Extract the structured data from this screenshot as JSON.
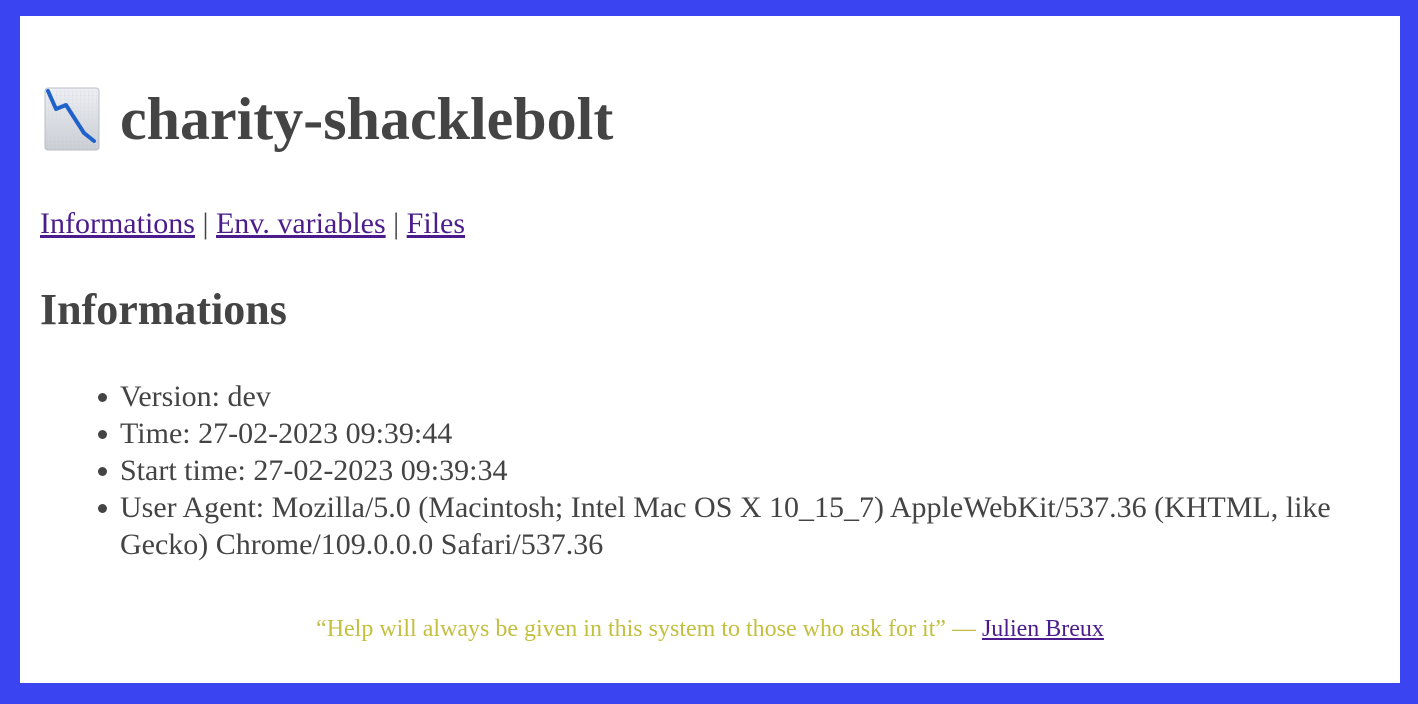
{
  "header": {
    "icon": "chart-decreasing-icon",
    "title": "charity-shacklebolt"
  },
  "nav": {
    "links": [
      "Informations",
      "Env. variables",
      "Files"
    ],
    "separator": "|"
  },
  "section": {
    "title": "Informations"
  },
  "info": [
    {
      "label": "Version:",
      "value": "dev"
    },
    {
      "label": "Time:",
      "value": "27-02-2023 09:39:44"
    },
    {
      "label": "Start time:",
      "value": "27-02-2023 09:39:34"
    },
    {
      "label": "User Agent:",
      "value": "Mozilla/5.0 (Macintosh; Intel Mac OS X 10_15_7) AppleWebKit/537.36 (KHTML, like Gecko) Chrome/109.0.0.0 Safari/537.36"
    }
  ],
  "footer": {
    "quote": "“Help will always be given in this system to those who ask for it” —",
    "author": "Julien Breux"
  },
  "colors": {
    "frame": "#3a44f0",
    "text": "#444444",
    "link": "#4b1c8c",
    "quote": "#c3bf3f"
  }
}
